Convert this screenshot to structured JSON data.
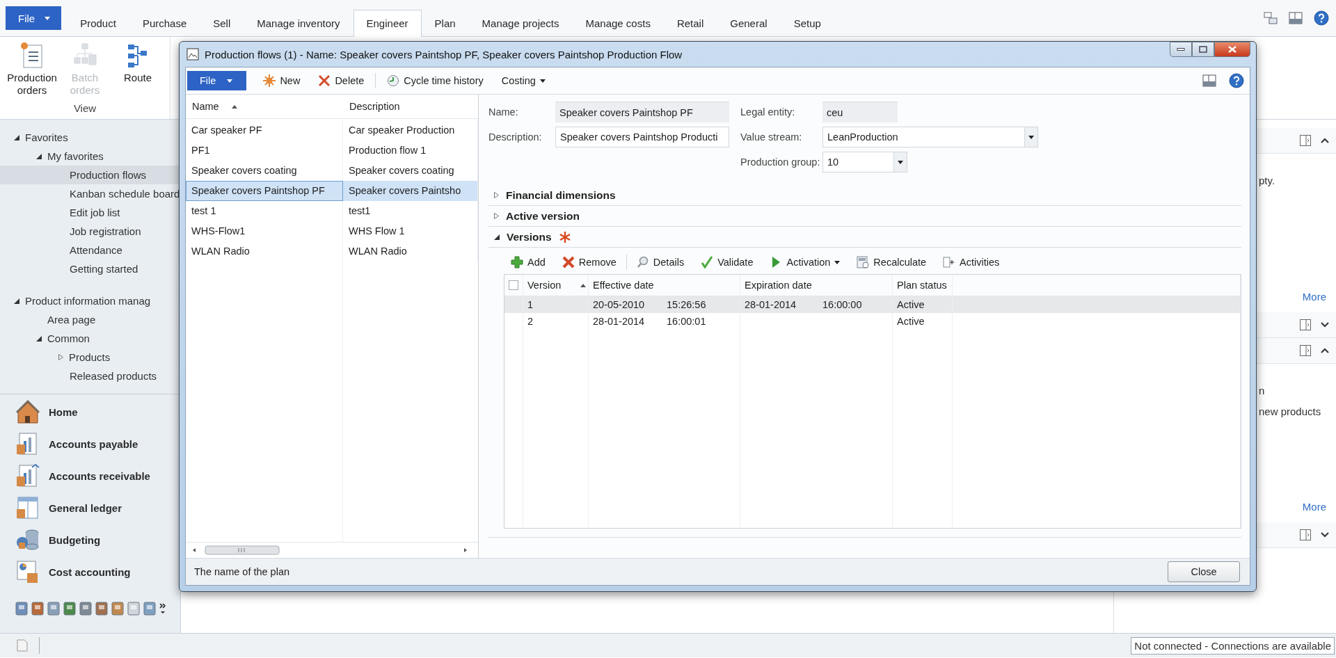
{
  "file_menu": {
    "label": "File"
  },
  "ribbon_tabs": [
    {
      "label": "Product",
      "selected": false
    },
    {
      "label": "Purchase",
      "selected": false
    },
    {
      "label": "Sell",
      "selected": false
    },
    {
      "label": "Manage inventory",
      "selected": false
    },
    {
      "label": "Engineer",
      "selected": true
    },
    {
      "label": "Plan",
      "selected": false
    },
    {
      "label": "Manage projects",
      "selected": false
    },
    {
      "label": "Manage costs",
      "selected": false
    },
    {
      "label": "Retail",
      "selected": false
    },
    {
      "label": "General",
      "selected": false
    },
    {
      "label": "Setup",
      "selected": false
    }
  ],
  "ribbon_groups": [
    {
      "label": "View",
      "buttons": [
        {
          "label": "Production orders",
          "kind": "orders",
          "disabled": false
        },
        {
          "label": "Batch orders",
          "kind": "batch",
          "disabled": true
        },
        {
          "label": "Route",
          "kind": "route",
          "disabled": false
        }
      ]
    }
  ],
  "navigation": {
    "tree": [
      {
        "label": "Favorites",
        "expanded": true,
        "selected": false,
        "children": [
          {
            "label": "My favorites",
            "expanded": true,
            "selected": false,
            "children": [
              {
                "label": "Production flows",
                "selected": true
              },
              {
                "label": "Kanban schedule board",
                "selected": false
              },
              {
                "label": "Edit job list",
                "selected": false
              },
              {
                "label": "Job registration",
                "selected": false
              },
              {
                "label": "Attendance",
                "selected": false
              },
              {
                "label": "Getting started",
                "selected": false
              }
            ]
          }
        ]
      },
      {
        "label": "Product information manag",
        "expanded": true,
        "selected": false,
        "children": [
          {
            "label": "Area page",
            "selected": false
          },
          {
            "label": "Common",
            "expanded": true,
            "selected": false,
            "children": [
              {
                "label": "Products",
                "expanded": false,
                "selected": false
              },
              {
                "label": "Released products",
                "selected": false
              }
            ]
          }
        ]
      }
    ],
    "modules": [
      {
        "label": "Home",
        "kind": "home"
      },
      {
        "label": "Accounts payable",
        "kind": "payable"
      },
      {
        "label": "Accounts receivable",
        "kind": "receivable"
      },
      {
        "label": "General ledger",
        "kind": "ledger"
      },
      {
        "label": "Budgeting",
        "kind": "budget"
      },
      {
        "label": "Cost accounting",
        "kind": "cost"
      }
    ]
  },
  "right_pane": {
    "sections": [
      {
        "expanded": true,
        "lines": [
          "pty."
        ],
        "link": "More"
      },
      {
        "expanded": false
      },
      {
        "expanded": true,
        "lines": [
          "n",
          "new products"
        ],
        "link": "More"
      },
      {
        "expanded": false
      }
    ]
  },
  "status_bar": {
    "connection": "Not connected - Connections are available"
  },
  "dialog": {
    "title": "Production flows (1) - Name: Speaker covers Paintshop PF, Speaker covers Paintshop Production Flow",
    "toolbar": [
      {
        "label": "File",
        "kind": "file",
        "has_menu": true
      },
      {
        "label": "New",
        "kind": "new",
        "has_menu": false
      },
      {
        "label": "Delete",
        "kind": "delete",
        "has_menu": false
      },
      {
        "label": "Cycle time history",
        "kind": "history",
        "has_menu": false
      },
      {
        "label": "Costing",
        "kind": "plain",
        "has_menu": true
      }
    ],
    "list": {
      "columns": [
        {
          "label": "Name",
          "sort_ascending": true
        },
        {
          "label": "Description",
          "sort_ascending": false
        }
      ],
      "rows": [
        {
          "name": "Car speaker PF",
          "description": "Car speaker Production",
          "selected": false
        },
        {
          "name": "PF1",
          "description": "Production flow 1",
          "selected": false
        },
        {
          "name": "Speaker covers coating",
          "description": "Speaker covers coating",
          "selected": false
        },
        {
          "name": "Speaker covers Paintshop PF",
          "description": "Speaker covers Paintsho",
          "selected": true
        },
        {
          "name": "test 1",
          "description": "test1",
          "selected": false
        },
        {
          "name": "WHS-Flow1",
          "description": "WHS Flow 1",
          "selected": false
        },
        {
          "name": "WLAN Radio",
          "description": "WLAN Radio",
          "selected": false
        }
      ]
    },
    "field_groups": [
      [
        {
          "label": "Name:",
          "value": "Speaker covers Paintshop PF",
          "kind": "readonly"
        },
        {
          "label": "Description:",
          "value": "Speaker covers Paintshop Producti",
          "kind": "text"
        }
      ],
      [
        {
          "label": "Legal entity:",
          "value": "ceu",
          "kind": "readonly"
        },
        {
          "label": "Value stream:",
          "value": "LeanProduction",
          "kind": "dropdown"
        },
        {
          "label": "Production group:",
          "value": "10",
          "kind": "dropdown"
        }
      ]
    ],
    "fasttabs": [
      {
        "label": "Financial dimensions",
        "expanded": false,
        "required": false
      },
      {
        "label": "Active version",
        "expanded": false,
        "required": false
      },
      {
        "label": "Versions",
        "expanded": true,
        "required": true
      }
    ],
    "versions": {
      "toolbar": [
        {
          "label": "Add",
          "kind": "add",
          "has_menu": false
        },
        {
          "label": "Remove",
          "kind": "remove",
          "has_menu": false
        },
        {
          "label": "Details",
          "kind": "details",
          "has_menu": false
        },
        {
          "label": "Validate",
          "kind": "validate",
          "has_menu": false
        },
        {
          "label": "Activation",
          "kind": "activation",
          "has_menu": true
        },
        {
          "label": "Recalculate",
          "kind": "recalculate",
          "has_menu": false
        },
        {
          "label": "Activities",
          "kind": "activities",
          "has_menu": false
        }
      ],
      "select_all_checked": false,
      "columns": [
        {
          "label": "Version",
          "sort_ascending": true
        },
        {
          "label": "Effective date",
          "sort_ascending": false
        },
        {
          "label": "Expiration date",
          "sort_ascending": false
        },
        {
          "label": "Plan status",
          "sort_ascending": false
        }
      ],
      "rows": [
        {
          "version": "1",
          "effective_date": "20-05-2010",
          "effective_time": "15:26:56",
          "expiration_date": "28-01-2014",
          "expiration_time": "16:00:00",
          "plan_status": "Active",
          "selected": true
        },
        {
          "version": "2",
          "effective_date": "28-01-2014",
          "effective_time": "16:00:01",
          "plan_status": "Active",
          "selected": false
        }
      ]
    },
    "status_text": "The name of the plan",
    "close_button": "Close"
  }
}
